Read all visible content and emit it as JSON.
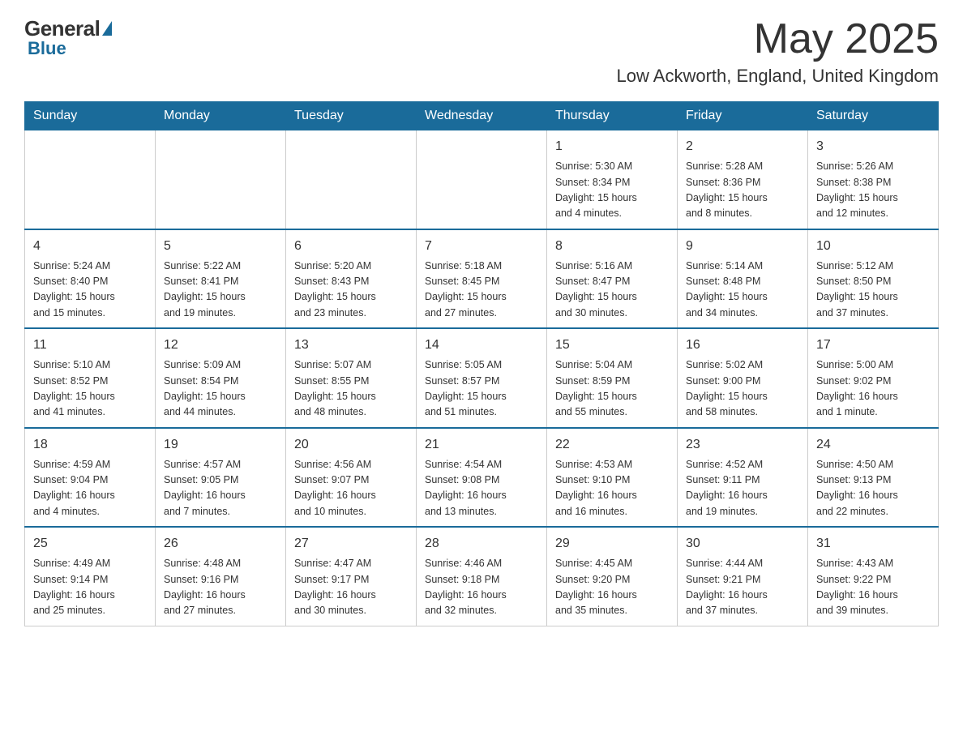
{
  "header": {
    "logo_general": "General",
    "logo_blue": "Blue",
    "month_title": "May 2025",
    "location": "Low Ackworth, England, United Kingdom"
  },
  "weekdays": [
    "Sunday",
    "Monday",
    "Tuesday",
    "Wednesday",
    "Thursday",
    "Friday",
    "Saturday"
  ],
  "weeks": [
    [
      {
        "day": "",
        "info": ""
      },
      {
        "day": "",
        "info": ""
      },
      {
        "day": "",
        "info": ""
      },
      {
        "day": "",
        "info": ""
      },
      {
        "day": "1",
        "info": "Sunrise: 5:30 AM\nSunset: 8:34 PM\nDaylight: 15 hours\nand 4 minutes."
      },
      {
        "day": "2",
        "info": "Sunrise: 5:28 AM\nSunset: 8:36 PM\nDaylight: 15 hours\nand 8 minutes."
      },
      {
        "day": "3",
        "info": "Sunrise: 5:26 AM\nSunset: 8:38 PM\nDaylight: 15 hours\nand 12 minutes."
      }
    ],
    [
      {
        "day": "4",
        "info": "Sunrise: 5:24 AM\nSunset: 8:40 PM\nDaylight: 15 hours\nand 15 minutes."
      },
      {
        "day": "5",
        "info": "Sunrise: 5:22 AM\nSunset: 8:41 PM\nDaylight: 15 hours\nand 19 minutes."
      },
      {
        "day": "6",
        "info": "Sunrise: 5:20 AM\nSunset: 8:43 PM\nDaylight: 15 hours\nand 23 minutes."
      },
      {
        "day": "7",
        "info": "Sunrise: 5:18 AM\nSunset: 8:45 PM\nDaylight: 15 hours\nand 27 minutes."
      },
      {
        "day": "8",
        "info": "Sunrise: 5:16 AM\nSunset: 8:47 PM\nDaylight: 15 hours\nand 30 minutes."
      },
      {
        "day": "9",
        "info": "Sunrise: 5:14 AM\nSunset: 8:48 PM\nDaylight: 15 hours\nand 34 minutes."
      },
      {
        "day": "10",
        "info": "Sunrise: 5:12 AM\nSunset: 8:50 PM\nDaylight: 15 hours\nand 37 minutes."
      }
    ],
    [
      {
        "day": "11",
        "info": "Sunrise: 5:10 AM\nSunset: 8:52 PM\nDaylight: 15 hours\nand 41 minutes."
      },
      {
        "day": "12",
        "info": "Sunrise: 5:09 AM\nSunset: 8:54 PM\nDaylight: 15 hours\nand 44 minutes."
      },
      {
        "day": "13",
        "info": "Sunrise: 5:07 AM\nSunset: 8:55 PM\nDaylight: 15 hours\nand 48 minutes."
      },
      {
        "day": "14",
        "info": "Sunrise: 5:05 AM\nSunset: 8:57 PM\nDaylight: 15 hours\nand 51 minutes."
      },
      {
        "day": "15",
        "info": "Sunrise: 5:04 AM\nSunset: 8:59 PM\nDaylight: 15 hours\nand 55 minutes."
      },
      {
        "day": "16",
        "info": "Sunrise: 5:02 AM\nSunset: 9:00 PM\nDaylight: 15 hours\nand 58 minutes."
      },
      {
        "day": "17",
        "info": "Sunrise: 5:00 AM\nSunset: 9:02 PM\nDaylight: 16 hours\nand 1 minute."
      }
    ],
    [
      {
        "day": "18",
        "info": "Sunrise: 4:59 AM\nSunset: 9:04 PM\nDaylight: 16 hours\nand 4 minutes."
      },
      {
        "day": "19",
        "info": "Sunrise: 4:57 AM\nSunset: 9:05 PM\nDaylight: 16 hours\nand 7 minutes."
      },
      {
        "day": "20",
        "info": "Sunrise: 4:56 AM\nSunset: 9:07 PM\nDaylight: 16 hours\nand 10 minutes."
      },
      {
        "day": "21",
        "info": "Sunrise: 4:54 AM\nSunset: 9:08 PM\nDaylight: 16 hours\nand 13 minutes."
      },
      {
        "day": "22",
        "info": "Sunrise: 4:53 AM\nSunset: 9:10 PM\nDaylight: 16 hours\nand 16 minutes."
      },
      {
        "day": "23",
        "info": "Sunrise: 4:52 AM\nSunset: 9:11 PM\nDaylight: 16 hours\nand 19 minutes."
      },
      {
        "day": "24",
        "info": "Sunrise: 4:50 AM\nSunset: 9:13 PM\nDaylight: 16 hours\nand 22 minutes."
      }
    ],
    [
      {
        "day": "25",
        "info": "Sunrise: 4:49 AM\nSunset: 9:14 PM\nDaylight: 16 hours\nand 25 minutes."
      },
      {
        "day": "26",
        "info": "Sunrise: 4:48 AM\nSunset: 9:16 PM\nDaylight: 16 hours\nand 27 minutes."
      },
      {
        "day": "27",
        "info": "Sunrise: 4:47 AM\nSunset: 9:17 PM\nDaylight: 16 hours\nand 30 minutes."
      },
      {
        "day": "28",
        "info": "Sunrise: 4:46 AM\nSunset: 9:18 PM\nDaylight: 16 hours\nand 32 minutes."
      },
      {
        "day": "29",
        "info": "Sunrise: 4:45 AM\nSunset: 9:20 PM\nDaylight: 16 hours\nand 35 minutes."
      },
      {
        "day": "30",
        "info": "Sunrise: 4:44 AM\nSunset: 9:21 PM\nDaylight: 16 hours\nand 37 minutes."
      },
      {
        "day": "31",
        "info": "Sunrise: 4:43 AM\nSunset: 9:22 PM\nDaylight: 16 hours\nand 39 minutes."
      }
    ]
  ]
}
